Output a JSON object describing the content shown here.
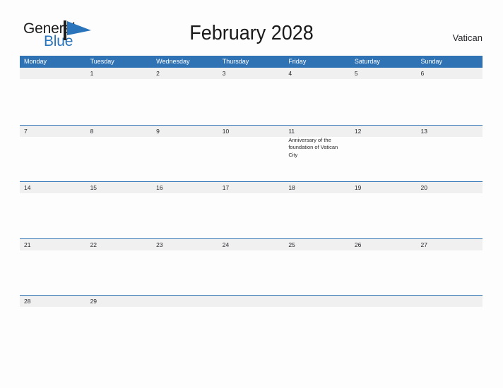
{
  "brand": {
    "name_part1": "General",
    "name_part2": "Blue",
    "flag_color": "#2a74bb",
    "pole_color": "#1d1d1d"
  },
  "header": {
    "title": "February 2028",
    "country": "Vatican"
  },
  "theme": {
    "header_blue": "#2f73b5",
    "band_gray": "#f0f0f0",
    "page_background": "#fdfdfd",
    "text_color": "#27272c"
  },
  "calendar": {
    "weekdays": [
      "Monday",
      "Tuesday",
      "Wednesday",
      "Thursday",
      "Friday",
      "Saturday",
      "Sunday"
    ],
    "weeks": [
      [
        {
          "day": "",
          "events": []
        },
        {
          "day": "1",
          "events": []
        },
        {
          "day": "2",
          "events": []
        },
        {
          "day": "3",
          "events": []
        },
        {
          "day": "4",
          "events": []
        },
        {
          "day": "5",
          "events": []
        },
        {
          "day": "6",
          "events": []
        }
      ],
      [
        {
          "day": "7",
          "events": []
        },
        {
          "day": "8",
          "events": []
        },
        {
          "day": "9",
          "events": []
        },
        {
          "day": "10",
          "events": []
        },
        {
          "day": "11",
          "events": [
            "Anniversary of the foundation of Vatican City"
          ]
        },
        {
          "day": "12",
          "events": []
        },
        {
          "day": "13",
          "events": []
        }
      ],
      [
        {
          "day": "14",
          "events": []
        },
        {
          "day": "15",
          "events": []
        },
        {
          "day": "16",
          "events": []
        },
        {
          "day": "17",
          "events": []
        },
        {
          "day": "18",
          "events": []
        },
        {
          "day": "19",
          "events": []
        },
        {
          "day": "20",
          "events": []
        }
      ],
      [
        {
          "day": "21",
          "events": []
        },
        {
          "day": "22",
          "events": []
        },
        {
          "day": "23",
          "events": []
        },
        {
          "day": "24",
          "events": []
        },
        {
          "day": "25",
          "events": []
        },
        {
          "day": "26",
          "events": []
        },
        {
          "day": "27",
          "events": []
        }
      ],
      [
        {
          "day": "28",
          "events": []
        },
        {
          "day": "29",
          "events": []
        },
        {
          "day": "",
          "events": []
        },
        {
          "day": "",
          "events": []
        },
        {
          "day": "",
          "events": []
        },
        {
          "day": "",
          "events": []
        },
        {
          "day": "",
          "events": []
        }
      ]
    ]
  }
}
